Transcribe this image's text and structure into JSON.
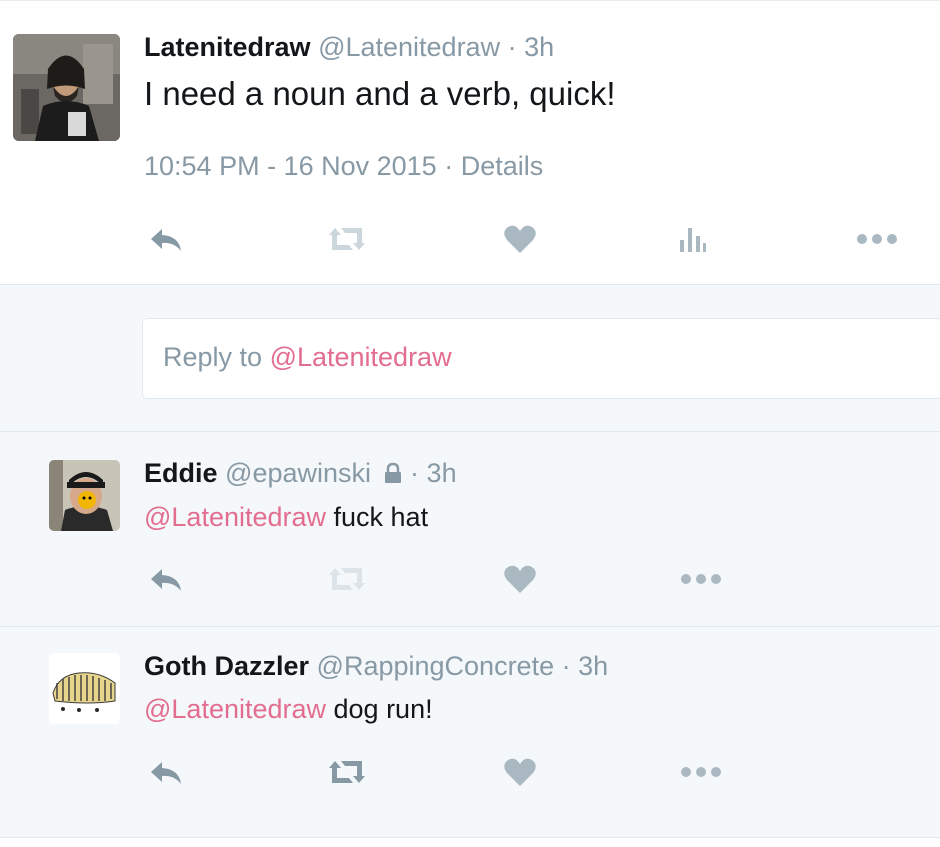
{
  "main_tweet": {
    "fullname": "Latenitedraw",
    "handle": "@Latenitedraw",
    "separator": "·",
    "time": "3h",
    "text": "I need a noun and a verb, quick!",
    "timestamp": "10:54 PM - 16 Nov 2015",
    "details_sep": "·",
    "details": "Details",
    "actions": [
      "reply-icon",
      "retweet-icon",
      "like-icon",
      "analytics-icon",
      "more-icon"
    ]
  },
  "reply_box": {
    "prefix": "Reply to ",
    "mention": "@Latenitedraw"
  },
  "replies": [
    {
      "fullname": "Eddie",
      "handle": "@epawinski",
      "protected": true,
      "separator": "·",
      "time": "3h",
      "mention": "@Latenitedraw",
      "text": " fuck hat"
    },
    {
      "fullname": "Goth Dazzler",
      "handle": "@RappingConcrete",
      "protected": false,
      "separator": "·",
      "time": "3h",
      "mention": "@Latenitedraw",
      "text": " dog run!"
    }
  ],
  "colors": {
    "mention": "#e36d8f",
    "muted": "#8899a6",
    "icon": "#aab8c2",
    "icon_disabled": "#ccd6dd",
    "background": "#f5f8fa"
  }
}
